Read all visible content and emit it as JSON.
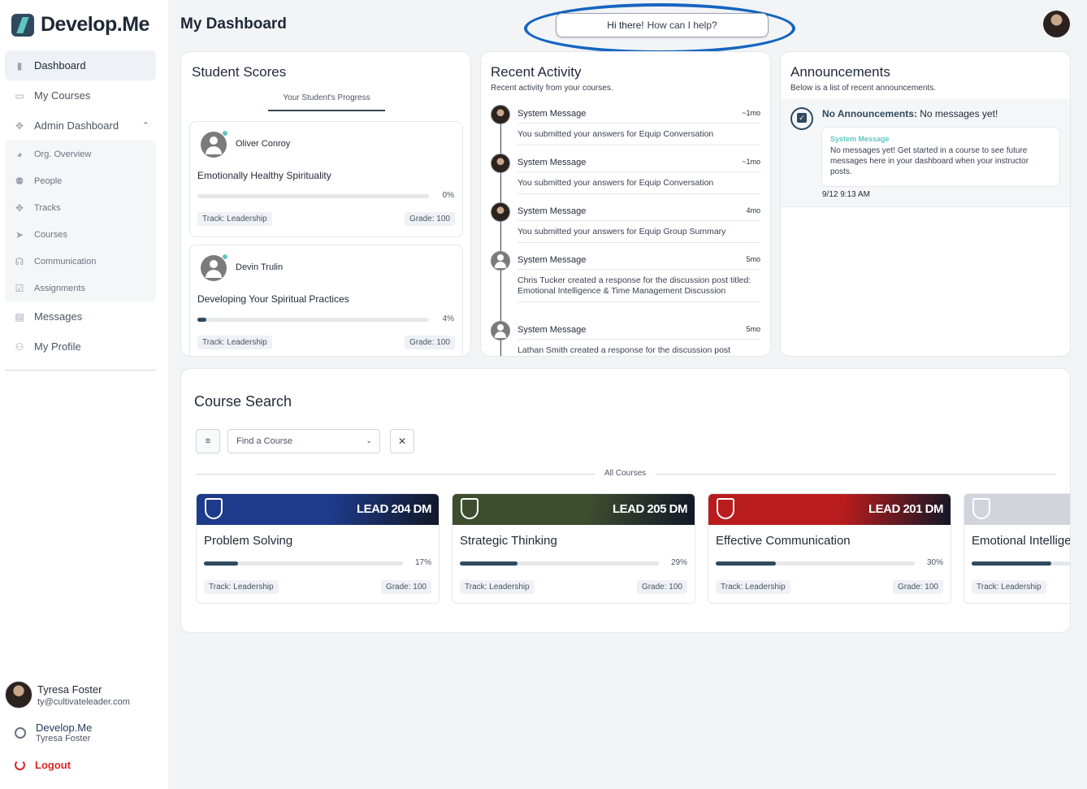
{
  "brand": {
    "name": "Develop.Me"
  },
  "sidebar": {
    "items": [
      {
        "label": "Dashboard",
        "icon": "bar-chart-icon"
      },
      {
        "label": "My Courses",
        "icon": "laptop-icon"
      },
      {
        "label": "Admin Dashboard",
        "icon": "move-icon"
      }
    ],
    "admin_sub": [
      {
        "label": "Org. Overview",
        "icon": "pie-chart-icon"
      },
      {
        "label": "People",
        "icon": "people-icon"
      },
      {
        "label": "Tracks",
        "icon": "move-icon"
      },
      {
        "label": "Courses",
        "icon": "send-icon"
      },
      {
        "label": "Communication",
        "icon": "voice-icon"
      },
      {
        "label": "Assignments",
        "icon": "check-square-icon"
      }
    ],
    "items2": [
      {
        "label": "Messages",
        "icon": "chat-icon"
      },
      {
        "label": "My Profile",
        "icon": "person-icon"
      }
    ],
    "user": {
      "name": "Tyresa Foster",
      "email": "ty@cultivateleader.com"
    },
    "org": {
      "name": "Develop.Me",
      "sub": "Tyresa Foster"
    },
    "logout": "Logout"
  },
  "header": {
    "title": "My Dashboard",
    "help_bold": "Hi there!",
    "help_rest": "How can I help?"
  },
  "scores": {
    "title": "Student Scores",
    "tab": "Your Student's Progress",
    "students": [
      {
        "name": "Oliver Conroy",
        "course": "Emotionally Healthy Spirituality",
        "progress": 0,
        "pct": "0%",
        "track": "Track: Leadership",
        "grade": "Grade: 100"
      },
      {
        "name": "Devin Trulin",
        "course": "Developing Your Spiritual Practices",
        "progress": 4,
        "pct": "4%",
        "track": "Track: Leadership",
        "grade": "Grade: 100"
      }
    ]
  },
  "activity": {
    "title": "Recent Activity",
    "subtitle": "Recent activity from your courses.",
    "items": [
      {
        "head": "System Message",
        "time": "~1mo",
        "body": "You submitted your answers for Equip Conversation",
        "avatar": "photo"
      },
      {
        "head": "System Message",
        "time": "~1mo",
        "body": "You submitted your answers for Equip Conversation",
        "avatar": "photo"
      },
      {
        "head": "System Message",
        "time": "4mo",
        "body": "You submitted your answers for Equip Group Summary",
        "avatar": "photo"
      },
      {
        "head": "System Message",
        "time": "5mo",
        "body": "Chris Tucker created a response for the discussion post titled: Emotional Intelligence & Time Management Discussion",
        "avatar": "generic"
      },
      {
        "head": "System Message",
        "time": "5mo",
        "body": "Lathan Smith created a response for the discussion post",
        "avatar": "generic"
      }
    ]
  },
  "announcements": {
    "title": "Announcements",
    "subtitle": "Below is a list of recent announcements.",
    "label": "No Announcements:",
    "label_rest": "No messages yet!",
    "box_title": "System Message",
    "box_text": "No messages yet! Get started in a course to see future messages here in your dashboard when your instructor posts.",
    "date": "9/12 9:13 AM"
  },
  "search": {
    "title": "Course Search",
    "placeholder": "Find a Course",
    "divider": "All Courses",
    "courses": [
      {
        "code": "LEAD 204 DM",
        "title": "Problem Solving",
        "progress": 17,
        "pct": "17%",
        "track": "Track: Leadership",
        "grade": "Grade: 100",
        "color": "#1e3a8a"
      },
      {
        "code": "LEAD 205 DM",
        "title": "Strategic Thinking",
        "progress": 29,
        "pct": "29%",
        "track": "Track: Leadership",
        "grade": "Grade: 100",
        "color": "#3f4d2f"
      },
      {
        "code": "LEAD 201 DM",
        "title": "Effective Communication",
        "progress": 30,
        "pct": "30%",
        "track": "Track: Leadership",
        "grade": "Grade: 100",
        "color": "#b91c1c"
      },
      {
        "code": "",
        "title": "Emotional Intellige",
        "progress": 40,
        "pct": "",
        "track": "Track: Leadership",
        "grade": "",
        "color": "#d1d5db"
      }
    ]
  }
}
